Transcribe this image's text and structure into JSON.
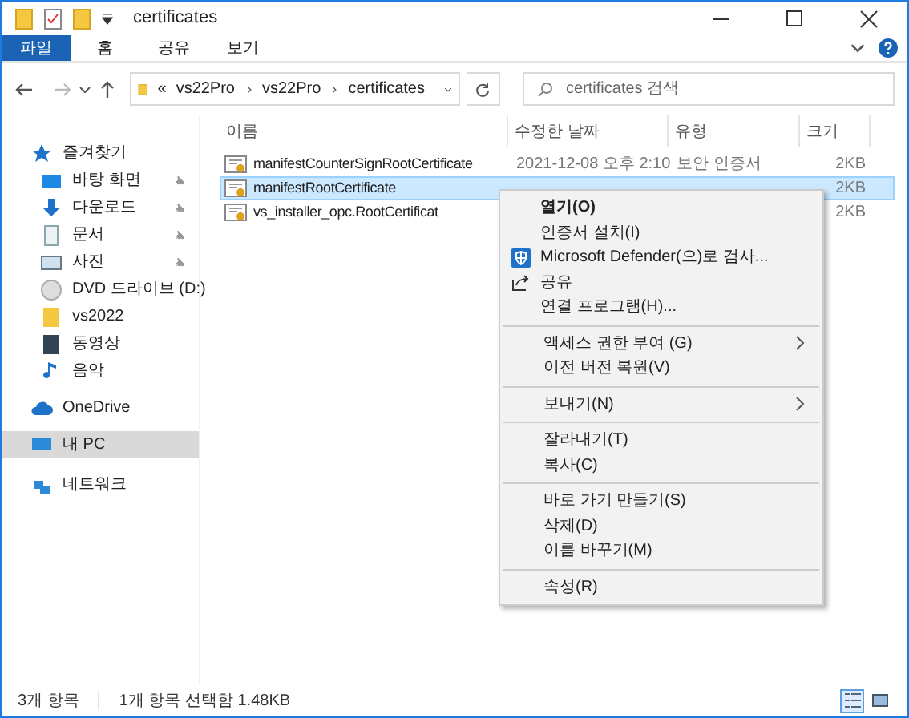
{
  "window": {
    "title": "certificates"
  },
  "ribbon_tabs": [
    {
      "label": "파일",
      "selected": true
    },
    {
      "label": "홈",
      "selected": false
    },
    {
      "label": "공유",
      "selected": false
    },
    {
      "label": "보기",
      "selected": false
    }
  ],
  "breadcrumb": [
    {
      "label": "«"
    },
    {
      "label": "vs22Pro"
    },
    {
      "label": "vs22Pro"
    },
    {
      "label": "certificates"
    }
  ],
  "search": {
    "placeholder": "certificates 검색"
  },
  "sidebar": {
    "items": [
      {
        "label": "즐겨찾기",
        "kind": "star",
        "selected": false,
        "children": [
          {
            "label": "바탕 화면",
            "kind": "desktop",
            "pinned": true,
            "selected": false
          },
          {
            "label": "다운로드",
            "kind": "download",
            "pinned": true,
            "selected": false
          },
          {
            "label": "문서",
            "kind": "document",
            "pinned": true,
            "selected": false
          },
          {
            "label": "사진",
            "kind": "picture",
            "pinned": true,
            "selected": false
          },
          {
            "label": "DVD 드라이브 (D:)",
            "kind": "disc",
            "pinned": false,
            "selected": false
          },
          {
            "label": "vs2022",
            "kind": "folder",
            "pinned": false,
            "selected": false
          },
          {
            "label": "동영상",
            "kind": "video",
            "pinned": false,
            "selected": false
          },
          {
            "label": "음악",
            "kind": "music",
            "pinned": false,
            "selected": false
          }
        ]
      },
      {
        "label": "OneDrive",
        "kind": "cloud",
        "selected": false
      },
      {
        "label": "내 PC",
        "kind": "pc",
        "selected": true
      },
      {
        "label": "네트워크",
        "kind": "network",
        "selected": false
      }
    ]
  },
  "table": {
    "columns": [
      "이름",
      "수정한 날짜",
      "유형",
      "크기"
    ],
    "rows": [
      {
        "name": "manifestCounterSignRootCertificate",
        "modified": "2021-12-08 오후 2:10",
        "type": "보안 인증서",
        "size": "2KB",
        "selected": false
      },
      {
        "name": "manifestRootCertificate",
        "size": "2KB",
        "selected": true
      },
      {
        "name": "vs_installer_opc.RootCertificat",
        "size": "2KB",
        "selected": false
      }
    ]
  },
  "context_menu": {
    "groups": [
      [
        {
          "label": "열기(O)",
          "default": true
        },
        {
          "label": "인증서 설치(I)",
          "default": false
        },
        {
          "label": "Microsoft Defender(으)로 검사...",
          "default": false,
          "kind": "shield"
        },
        {
          "label": "공유",
          "default": false,
          "kind": "share"
        },
        {
          "label": "연결 프로그램(H)...",
          "default": false
        }
      ],
      [
        {
          "label": "액세스 권한 부여 (G)",
          "default": false,
          "submenu": true
        },
        {
          "label": "이전 버전 복원(V)",
          "default": false
        }
      ],
      [
        {
          "label": "보내기(N)",
          "default": false,
          "submenu": true
        }
      ],
      [
        {
          "label": "잘라내기(T)",
          "default": false
        },
        {
          "label": "복사(C)",
          "default": false
        }
      ],
      [
        {
          "label": "바로 가기 만들기(S)",
          "default": false
        },
        {
          "label": "삭제(D)",
          "default": false
        },
        {
          "label": "이름 바꾸기(M)",
          "default": false
        }
      ],
      [
        {
          "label": "속성(R)",
          "default": false
        }
      ]
    ]
  },
  "status_bar": {
    "item_count": "3개 항목",
    "selection": "1개 항목 선택함 1.48KB",
    "views": [
      {
        "kind": "details",
        "selected": true
      },
      {
        "kind": "thumbnails",
        "selected": false
      }
    ]
  }
}
